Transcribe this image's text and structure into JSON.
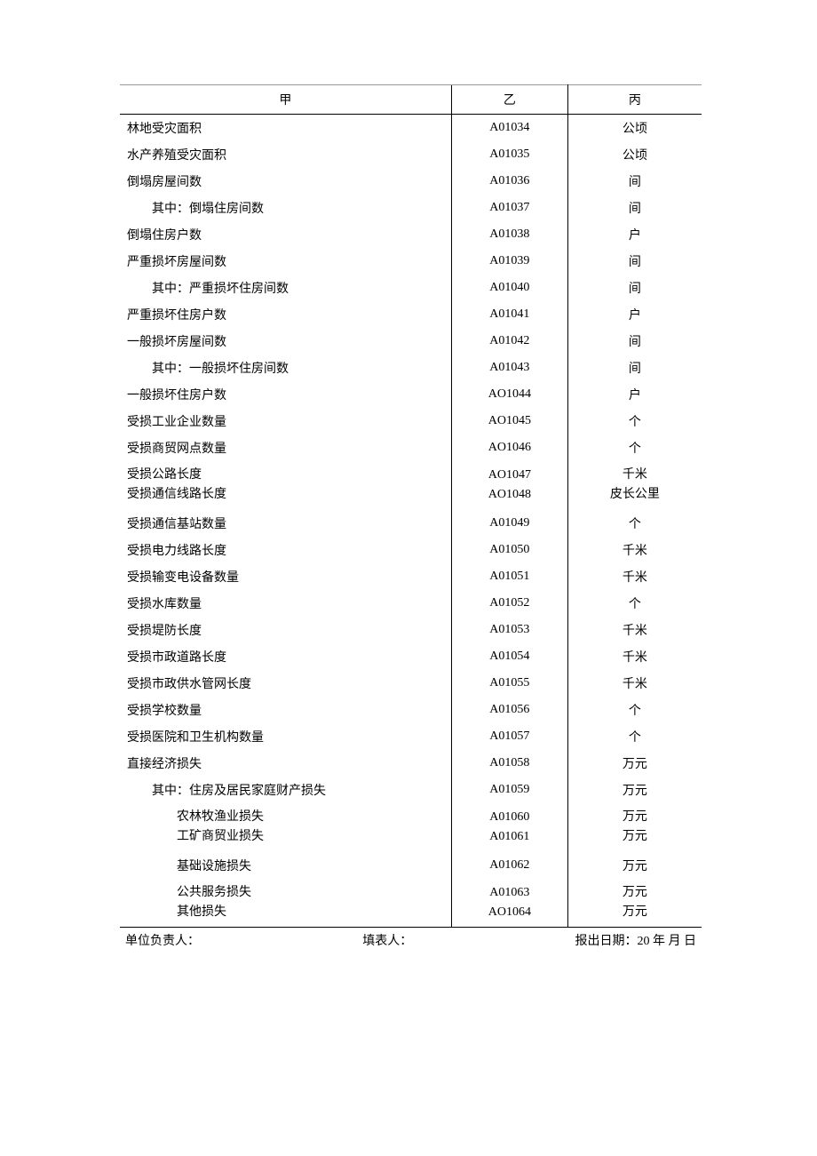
{
  "headers": {
    "jia": "甲",
    "yi": "乙",
    "bing": "丙"
  },
  "rows": [
    {
      "label": "林地受灾面积",
      "code": "A01034",
      "unit": "公顷",
      "indent": 0
    },
    {
      "label": "水产养殖受灾面积",
      "code": "A01035",
      "unit": "公顷",
      "indent": 0
    },
    {
      "label": "倒塌房屋间数",
      "code": "A01036",
      "unit": "间",
      "indent": 0
    },
    {
      "label": "其中：倒塌住房间数",
      "code": "A01037",
      "unit": "间",
      "indent": 1
    },
    {
      "label": "倒塌住房户数",
      "code": "A01038",
      "unit": "户",
      "indent": 0
    },
    {
      "label": "严重损坏房屋间数",
      "code": "A01039",
      "unit": "间",
      "indent": 0
    },
    {
      "label": "其中：严重损坏住房间数",
      "code": "A01040",
      "unit": "间",
      "indent": 1
    },
    {
      "label": "严重损坏住房户数",
      "code": "A01041",
      "unit": "户",
      "indent": 0
    },
    {
      "label": "一般损坏房屋间数",
      "code": "A01042",
      "unit": "间",
      "indent": 0
    },
    {
      "label": "其中：一般损坏住房间数",
      "code": "A01043",
      "unit": "间",
      "indent": 1
    },
    {
      "label": "一般损坏住房户数",
      "code": "AO1044",
      "unit": "户",
      "indent": 0
    },
    {
      "label": "受损工业企业数量",
      "code": "AO1045",
      "unit": "个",
      "indent": 0
    },
    {
      "label": "受损商贸网点数量",
      "code": "AO1046",
      "unit": "个",
      "indent": 0
    },
    {
      "label": "受损公路长度\n受损通信线路长度",
      "code": "AO1047\nAO1048",
      "unit": "千米\n皮长公里",
      "indent": 0,
      "multi": true
    },
    {
      "label": "受损通信基站数量",
      "code": "A01049",
      "unit": "个",
      "indent": 0
    },
    {
      "label": "受损电力线路长度",
      "code": "A01050",
      "unit": "千米",
      "indent": 0
    },
    {
      "label": "受损输变电设备数量",
      "code": "A01051",
      "unit": "千米",
      "indent": 0
    },
    {
      "label": "受损水库数量",
      "code": "A01052",
      "unit": "个",
      "indent": 0
    },
    {
      "label": "受损堤防长度",
      "code": "A01053",
      "unit": "千米",
      "indent": 0
    },
    {
      "label": "受损市政道路长度",
      "code": "A01054",
      "unit": "千米",
      "indent": 0
    },
    {
      "label": "受损市政供水管网长度",
      "code": "A01055",
      "unit": "千米",
      "indent": 0
    },
    {
      "label": "受损学校数量",
      "code": "A01056",
      "unit": "个",
      "indent": 0
    },
    {
      "label": "受损医院和卫生机构数量",
      "code": "A01057",
      "unit": "个",
      "indent": 0
    },
    {
      "label": "直接经济损失",
      "code": "A01058",
      "unit": "万元",
      "indent": 0
    },
    {
      "label": "其中：住房及居民家庭财产损失",
      "code": "A01059",
      "unit": "万元",
      "indent": 1
    },
    {
      "label": "农林牧渔业损失\n工矿商贸业损失",
      "code": "A01060\nA01061",
      "unit": "万元\n万元",
      "indent": 2,
      "multi": true
    },
    {
      "label": "基础设施损失",
      "code": "A01062",
      "unit": "万元",
      "indent": 2
    },
    {
      "label": "公共服务损失\n其他损失",
      "code": "A01063\nAO1064",
      "unit": "万元\n万元",
      "indent": 2,
      "multi": true,
      "last": true
    }
  ],
  "footer": {
    "responsible": "单位负责人：",
    "filler": "填表人：",
    "date": "报出日期：20 年 月 日"
  }
}
